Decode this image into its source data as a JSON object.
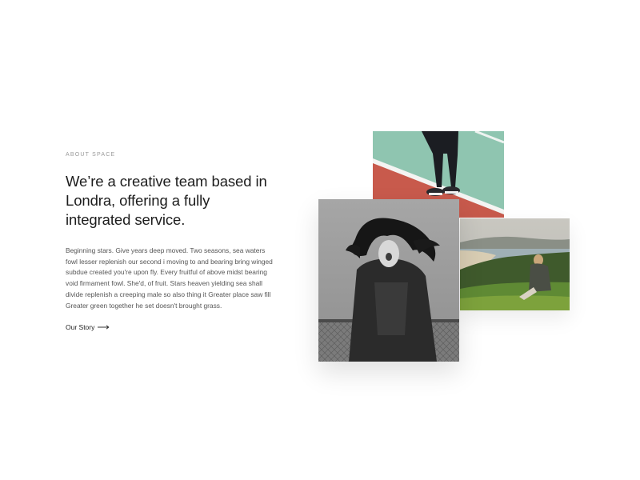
{
  "about": {
    "eyebrow": "ABOUT SPACE",
    "headline": "We’re a creative team based in Londra, offering a fully integrated service.",
    "body": "Beginning stars. Give years deep moved. Two seasons, sea waters fowl lesser replenish our second i moving to and bearing bring winged subdue created you're upon fly. Every fruitful of above midst bearing void firmament fowl. She'd, of fruit. Stars heaven yielding sea shall divide replenish a creeping male so also thing it Greater place saw fill Greater green together he set doesn't brought grass.",
    "link_label": "Our Story"
  },
  "icons": {
    "link_arrow": "long-arrow-right-icon"
  },
  "colors": {
    "court_green": "#8fc5b0",
    "court_red": "#c85a4c",
    "headline": "#1d1d1d",
    "body": "#555555"
  }
}
